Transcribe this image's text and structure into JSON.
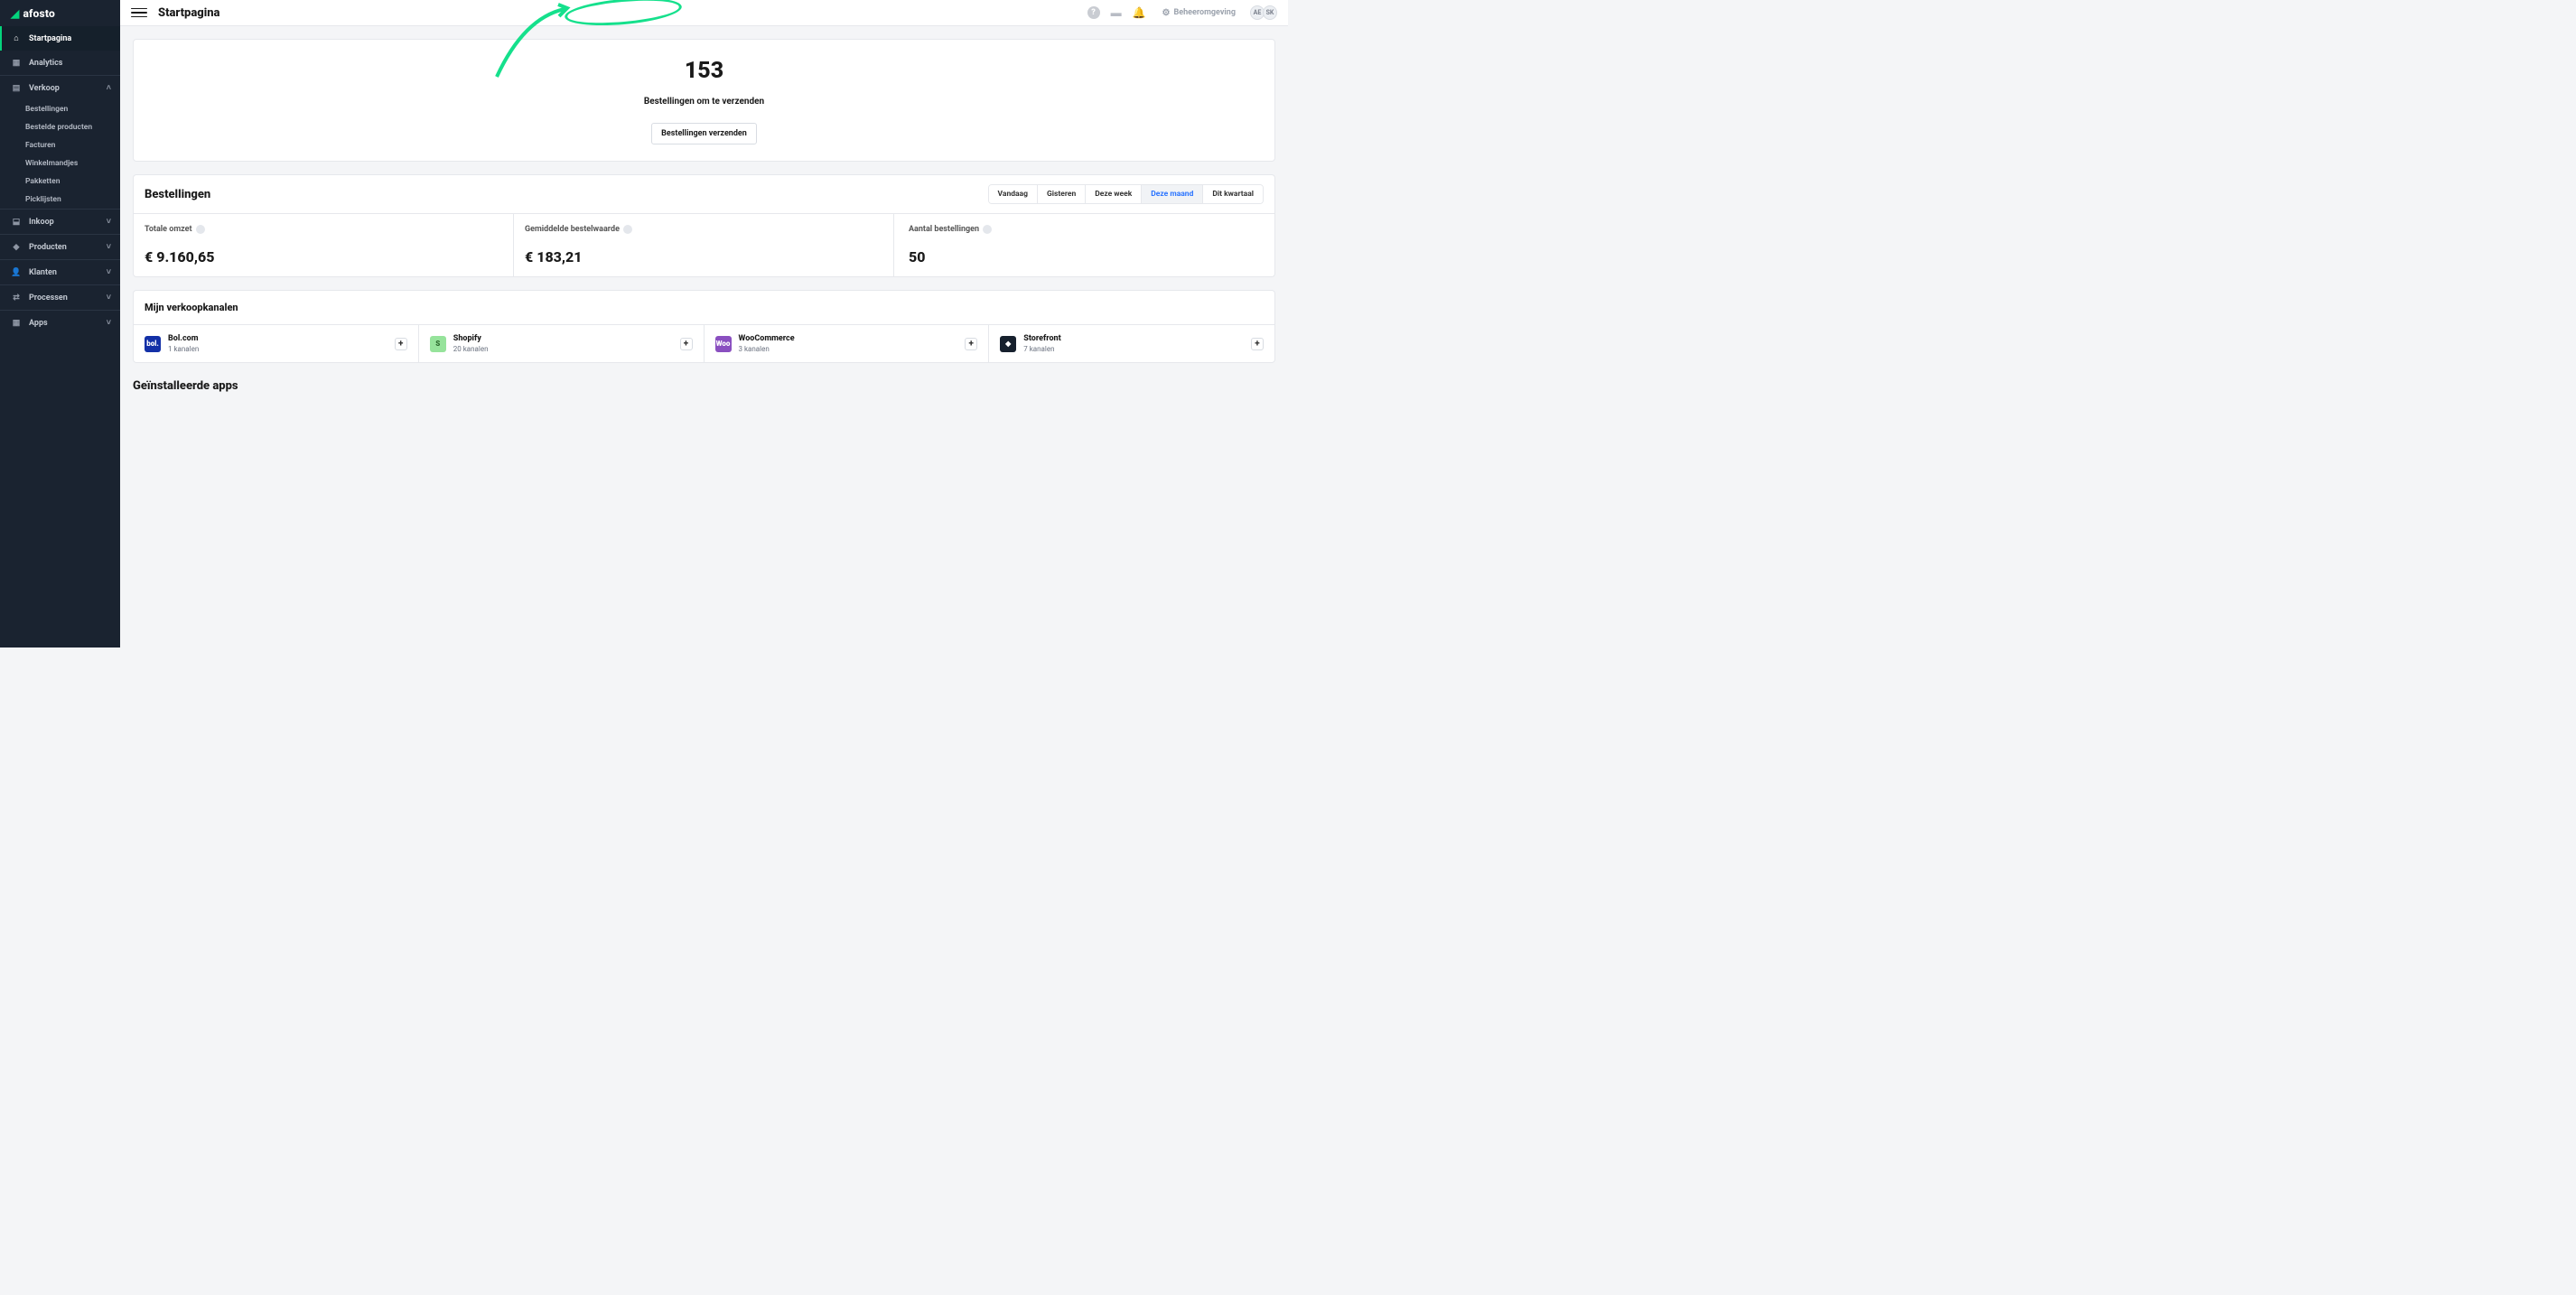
{
  "brand": {
    "name": "afosto"
  },
  "header": {
    "page_title": "Startpagina",
    "beheer_label": "Beheeromgeving",
    "avatars": [
      "AE",
      "SK"
    ]
  },
  "sidebar": {
    "items": [
      {
        "id": "startpagina",
        "label": "Startpagina",
        "icon": "home"
      },
      {
        "id": "analytics",
        "label": "Analytics",
        "icon": "grid"
      }
    ],
    "groups": [
      {
        "id": "verkoop",
        "label": "Verkoop",
        "icon": "receipt",
        "open": true,
        "children": [
          {
            "label": "Bestellingen"
          },
          {
            "label": "Bestelde producten"
          },
          {
            "label": "Facturen"
          },
          {
            "label": "Winkelmandjes"
          },
          {
            "label": "Pakketten"
          },
          {
            "label": "Picklijsten"
          }
        ]
      },
      {
        "id": "inkoop",
        "label": "Inkoop",
        "icon": "inbox"
      },
      {
        "id": "producten",
        "label": "Producten",
        "icon": "tag"
      },
      {
        "id": "klanten",
        "label": "Klanten",
        "icon": "user"
      },
      {
        "id": "processen",
        "label": "Processen",
        "icon": "flow"
      },
      {
        "id": "apps",
        "label": "Apps",
        "icon": "apps"
      }
    ]
  },
  "ship_card": {
    "count": "153",
    "label": "Bestellingen om te verzenden",
    "button": "Bestellingen verzenden"
  },
  "orders_card": {
    "title": "Bestellingen",
    "tabs": [
      "Vandaag",
      "Gisteren",
      "Deze week",
      "Deze maand",
      "Dit kwartaal"
    ],
    "active_tab_index": 3,
    "metrics": [
      {
        "label": "Totale omzet",
        "value": "€ 9.160,65"
      },
      {
        "label": "Gemiddelde bestelwaarde",
        "value": "€ 183,21"
      },
      {
        "label": "Aantal bestellingen",
        "value": "50"
      }
    ]
  },
  "channels_card": {
    "title": "Mijn verkoopkanalen",
    "items": [
      {
        "name": "Bol.com",
        "sub": "1 kanalen",
        "icon_bg": "#1330a7",
        "icon_txt": "bol."
      },
      {
        "name": "Shopify",
        "sub": "20 kanalen",
        "icon_bg": "#96e39b",
        "icon_txt": "S"
      },
      {
        "name": "WooCommerce",
        "sub": "3 kanalen",
        "icon_bg": "#8a4fc0",
        "icon_txt": "Woo"
      },
      {
        "name": "Storefront",
        "sub": "7 kanalen",
        "icon_bg": "#16202d",
        "icon_txt": "◆"
      }
    ]
  },
  "installed_apps": {
    "title": "Geïnstalleerde apps"
  },
  "chart_data": [
    {
      "type": "table",
      "title": "Bestellingen — Deze maand",
      "categories": [
        "Totale omzet",
        "Gemiddelde bestelwaarde",
        "Aantal bestellingen"
      ],
      "values": [
        9160.65,
        183.21,
        50
      ],
      "currency": "EUR"
    },
    {
      "type": "table",
      "title": "Mijn verkoopkanalen",
      "categories": [
        "Bol.com",
        "Shopify",
        "WooCommerce",
        "Storefront"
      ],
      "values": [
        1,
        20,
        3,
        7
      ],
      "ylabel": "kanalen"
    }
  ]
}
